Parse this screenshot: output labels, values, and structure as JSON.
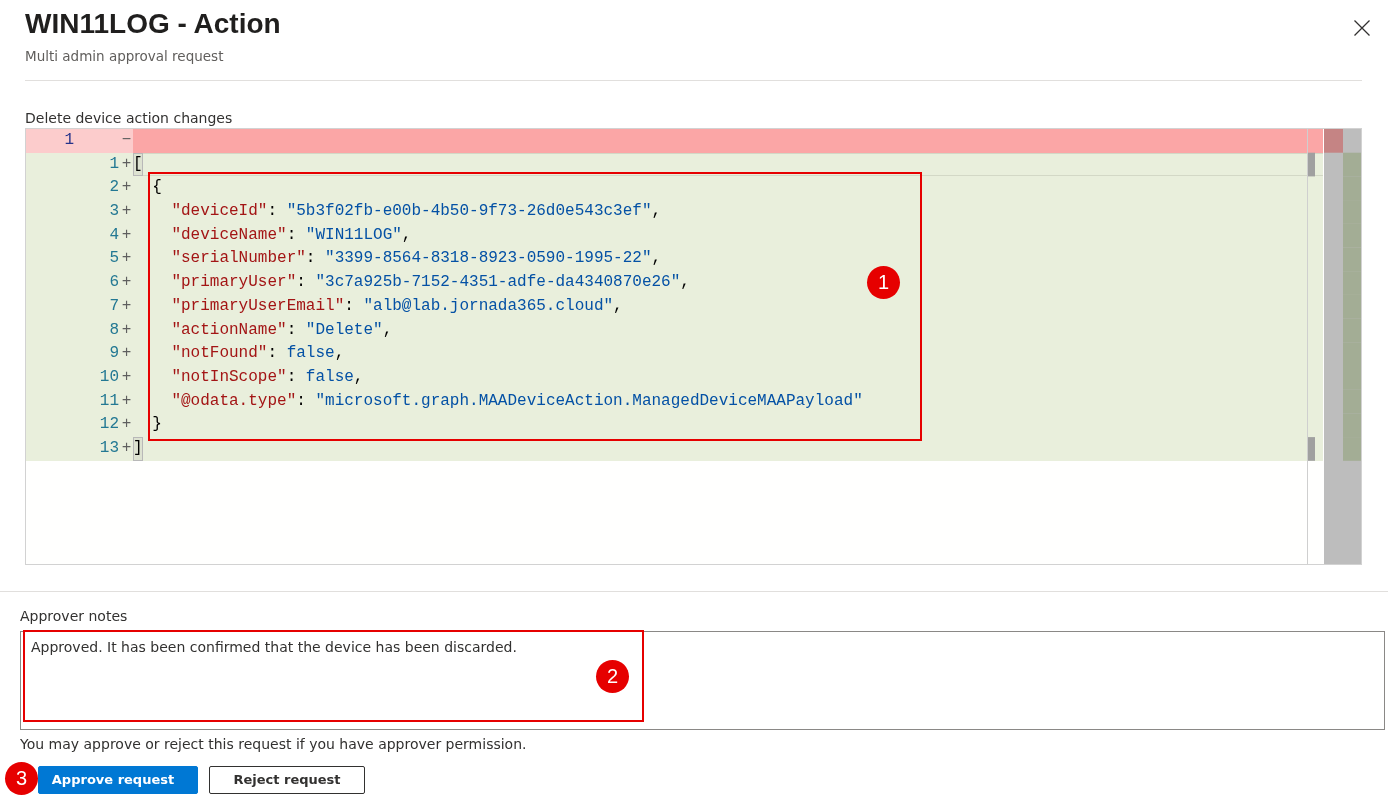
{
  "header": {
    "title": "WIN11LOG - Action",
    "subtitle": "Multi admin approval request"
  },
  "diff": {
    "label": "Delete device action changes",
    "rows": [
      {
        "kind": "removed",
        "old_number": "1",
        "marker": "−",
        "current": false,
        "bracket_highlight": false
      },
      {
        "kind": "added",
        "new_number": "1",
        "marker": "+",
        "code": "[",
        "current": true,
        "bracket_highlight": true
      },
      {
        "kind": "added",
        "new_number": "2",
        "marker": "+",
        "code": "  {",
        "current": false,
        "bracket_highlight": false
      },
      {
        "kind": "added",
        "new_number": "3",
        "marker": "+",
        "code": "    \"deviceId\": \"5b3f02fb-e00b-4b50-9f73-26d0e543c3ef\",",
        "current": false,
        "bracket_highlight": false
      },
      {
        "kind": "added",
        "new_number": "4",
        "marker": "+",
        "code": "    \"deviceName\": \"WIN11LOG\",",
        "current": false,
        "bracket_highlight": false
      },
      {
        "kind": "added",
        "new_number": "5",
        "marker": "+",
        "code": "    \"serialNumber\": \"3399-8564-8318-8923-0590-1995-22\",",
        "current": false,
        "bracket_highlight": false
      },
      {
        "kind": "added",
        "new_number": "6",
        "marker": "+",
        "code": "    \"primaryUser\": \"3c7a925b-7152-4351-adfe-da4340870e26\",",
        "current": false,
        "bracket_highlight": false
      },
      {
        "kind": "added",
        "new_number": "7",
        "marker": "+",
        "code": "    \"primaryUserEmail\": \"alb@lab.jornada365.cloud\",",
        "current": false,
        "bracket_highlight": false
      },
      {
        "kind": "added",
        "new_number": "8",
        "marker": "+",
        "code": "    \"actionName\": \"Delete\",",
        "current": false,
        "bracket_highlight": false
      },
      {
        "kind": "added",
        "new_number": "9",
        "marker": "+",
        "code": "    \"notFound\": false,",
        "current": false,
        "bracket_highlight": false
      },
      {
        "kind": "added",
        "new_number": "10",
        "marker": "+",
        "code": "    \"notInScope\": false,",
        "current": false,
        "bracket_highlight": false
      },
      {
        "kind": "added",
        "new_number": "11",
        "marker": "+",
        "code": "    \"@odata.type\": \"microsoft.graph.MAADeviceAction.ManagedDeviceMAAPayload\"",
        "current": false,
        "bracket_highlight": false
      },
      {
        "kind": "added",
        "new_number": "12",
        "marker": "+",
        "code": "  }",
        "current": false,
        "bracket_highlight": false
      },
      {
        "kind": "added",
        "new_number": "13",
        "marker": "+",
        "code": "]",
        "current": false,
        "bracket_highlight": true
      }
    ],
    "annotation": {
      "label": "1",
      "outlined": true
    }
  },
  "notes": {
    "label": "Approver notes",
    "value": "Approved. It has been confirmed that the device has been discarded.",
    "annotation": {
      "label": "2",
      "outlined": true
    }
  },
  "hint": "You may approve or reject this request if you have approver permission.",
  "buttons": [
    {
      "label": "Approve request",
      "kind": "primary",
      "annotation": {
        "label": "3",
        "outlined": false
      }
    },
    {
      "label": "Reject request",
      "kind": "secondary"
    }
  ]
}
